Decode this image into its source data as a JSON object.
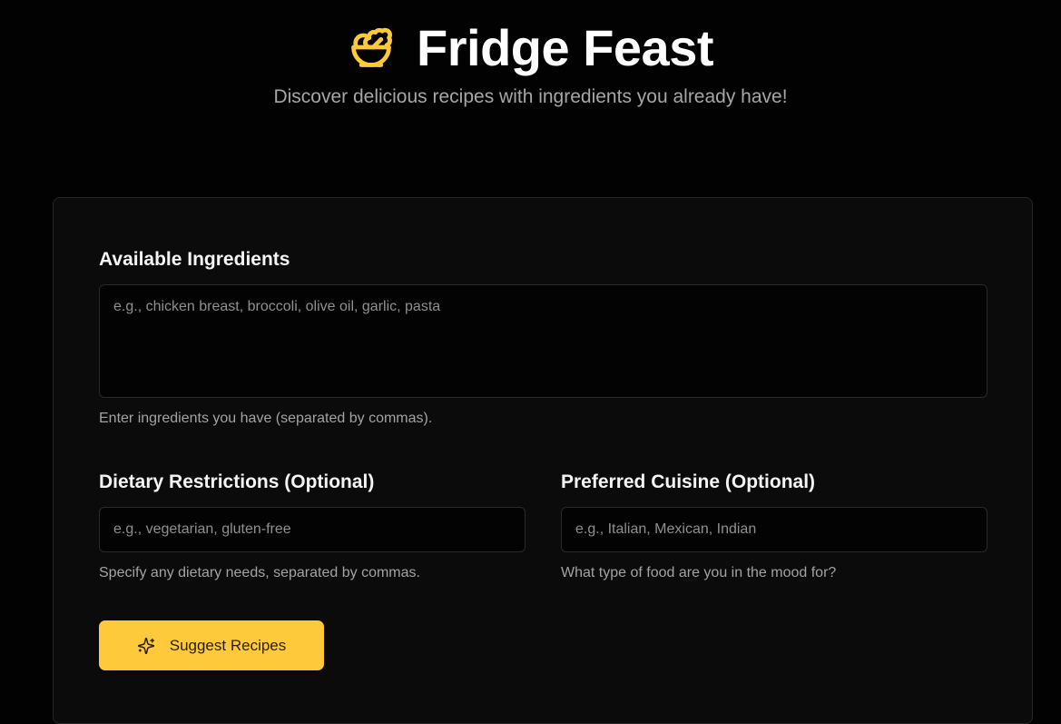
{
  "header": {
    "app_title": "Fridge Feast",
    "subtitle": "Discover delicious recipes with ingredients you already have!",
    "logo_icon": "salad-bowl-icon"
  },
  "form": {
    "ingredients": {
      "label": "Available Ingredients",
      "placeholder": "e.g., chicken breast, broccoli, olive oil, garlic, pasta",
      "value": "",
      "help": "Enter ingredients you have (separated by commas)."
    },
    "dietary": {
      "label": "Dietary Restrictions (Optional)",
      "placeholder": "e.g., vegetarian, gluten-free",
      "value": "",
      "help": "Specify any dietary needs, separated by commas."
    },
    "cuisine": {
      "label": "Preferred Cuisine (Optional)",
      "placeholder": "e.g., Italian, Mexican, Indian",
      "value": "",
      "help": "What type of food are you in the mood for?"
    },
    "submit": {
      "label": "Suggest Recipes",
      "icon": "sparkles-icon"
    }
  },
  "colors": {
    "background": "#020202",
    "card": "#0b0b0b",
    "accent": "#ffc93c",
    "text": "#ffffff",
    "muted": "#a3a3a3"
  }
}
